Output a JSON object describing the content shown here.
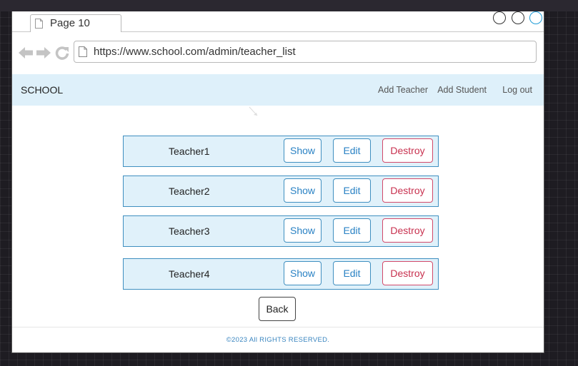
{
  "browser": {
    "tab_title": "Page 10",
    "url": "https://www.school.com/admin/teacher_list"
  },
  "navbar": {
    "brand": "SCHOOL",
    "links": [
      "Add Teacher",
      "Add Student",
      "Log out"
    ]
  },
  "teachers": [
    {
      "name": "Teacher1",
      "show_label": "Show",
      "edit_label": "Edit",
      "destroy_label": "Destroy"
    },
    {
      "name": "Teacher2",
      "show_label": "Show",
      "edit_label": "Edit",
      "destroy_label": "Destroy"
    },
    {
      "name": "Teacher3",
      "show_label": "Show",
      "edit_label": "Edit",
      "destroy_label": "Destroy"
    },
    {
      "name": "Teacher4",
      "show_label": "Show",
      "edit_label": "Edit",
      "destroy_label": "Destroy"
    }
  ],
  "back_label": "Back",
  "footer": {
    "text": "©2023 All RIGHTS RESERVED."
  },
  "icons": [
    "page-icon",
    "back-arrow-icon",
    "forward-arrow-icon",
    "reload-icon"
  ],
  "colors": {
    "navbar_bg": "#def0fa",
    "row_bg": "#e0f1fa",
    "primary": "#2a82c4",
    "danger": "#c8314f",
    "footer_text": "#3a86c0"
  }
}
